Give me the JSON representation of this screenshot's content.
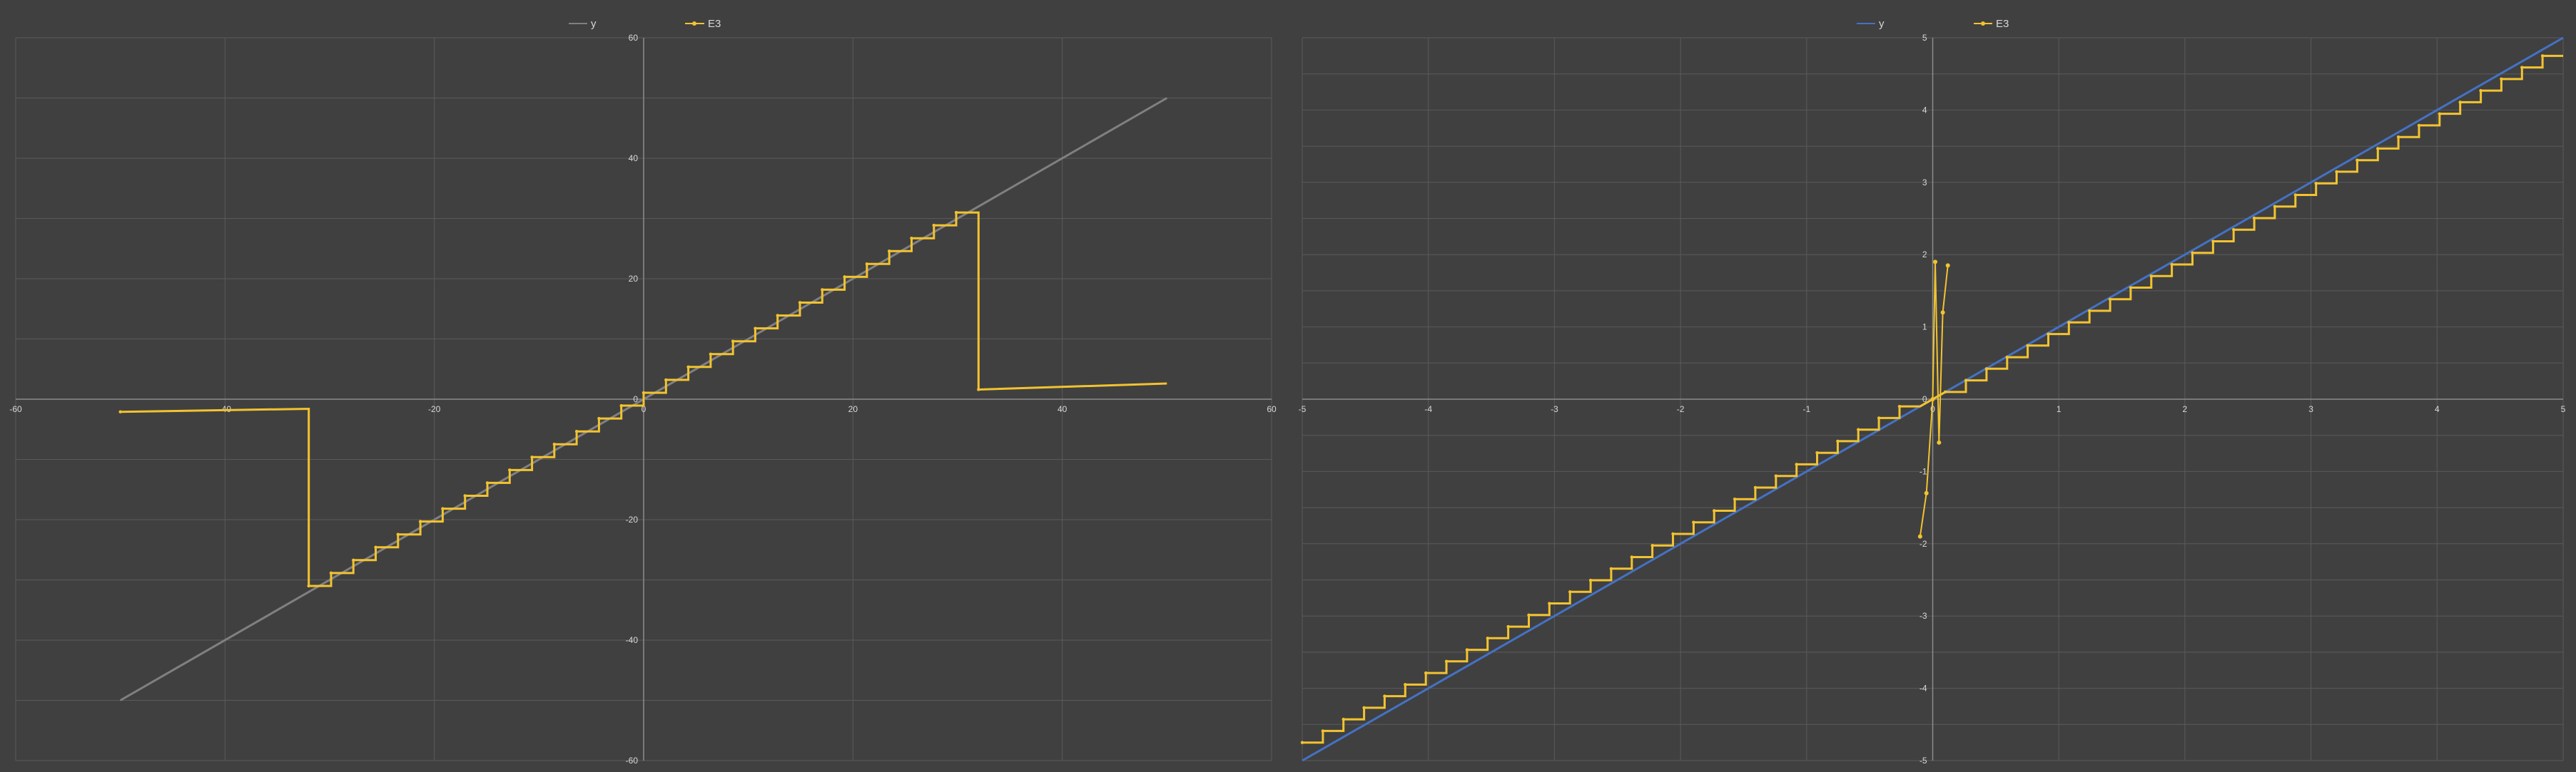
{
  "colors": {
    "background": "#404040",
    "grid": "#5a5a5a",
    "axis": "#8c8c8c",
    "tick_text": "#d9d9d9",
    "legend_text": "#d9d9d9"
  },
  "chart_data": [
    {
      "type": "line",
      "title": "",
      "xlabel": "",
      "ylabel": "",
      "xlim": [
        -60,
        60
      ],
      "ylim": [
        -60,
        60
      ],
      "xticks": [
        -60,
        -40,
        -20,
        0,
        20,
        40,
        60
      ],
      "yticks": [
        -60,
        -40,
        -20,
        0,
        20,
        40,
        60
      ],
      "grid": true,
      "legend": "top-center",
      "series": [
        {
          "name": "y",
          "color": "#808080",
          "points": [
            [
              -50,
              -50
            ],
            [
              50,
              50
            ]
          ]
        },
        {
          "name": "E3",
          "color": "#f2c330",
          "marker": "circle",
          "kind": "staircase",
          "segments": [
            {
              "from": -50,
              "to": -32,
              "y0": -2.1,
              "y1": -1.6
            },
            {
              "from": -32,
              "to": 32,
              "y0": -31,
              "y1": 31,
              "steps": 30
            },
            {
              "from": 32,
              "to": 50,
              "y0": 1.6,
              "y1": 2.6
            }
          ],
          "jumps": [
            [
              -32,
              -1.6,
              -31
            ],
            [
              32,
              31,
              1.6
            ]
          ]
        }
      ]
    },
    {
      "type": "line",
      "title": "",
      "xlabel": "",
      "ylabel": "",
      "xlim": [
        -5,
        5
      ],
      "ylim": [
        -5,
        5
      ],
      "xticks": [
        -5,
        -4,
        -3,
        -2,
        -1,
        0,
        1,
        2,
        3,
        4,
        5
      ],
      "yticks": [
        -5,
        -4,
        -3,
        -2,
        -1,
        0,
        1,
        2,
        3,
        4,
        5
      ],
      "grid": true,
      "legend": "top-center",
      "series": [
        {
          "name": "y",
          "color": "#4472c4",
          "points": [
            [
              -5,
              -5
            ],
            [
              5,
              5
            ]
          ]
        },
        {
          "name": "E3",
          "color": "#f2c330",
          "marker": "circle",
          "kind": "staircase",
          "segments": [
            {
              "from": -5,
              "to": -0.1,
              "y0": -4.75,
              "y1": -0.1,
              "steps": 30
            },
            {
              "from": 0.1,
              "to": 5,
              "y0": 0.1,
              "y1": 4.75,
              "steps": 30
            }
          ],
          "near_zero": [
            [
              -0.1,
              -1.9
            ],
            [
              -0.05,
              -1.3
            ],
            [
              0,
              0
            ],
            [
              0.02,
              1.9
            ],
            [
              0.05,
              -0.6
            ],
            [
              0.08,
              1.2
            ],
            [
              0.12,
              1.85
            ]
          ]
        }
      ]
    }
  ]
}
